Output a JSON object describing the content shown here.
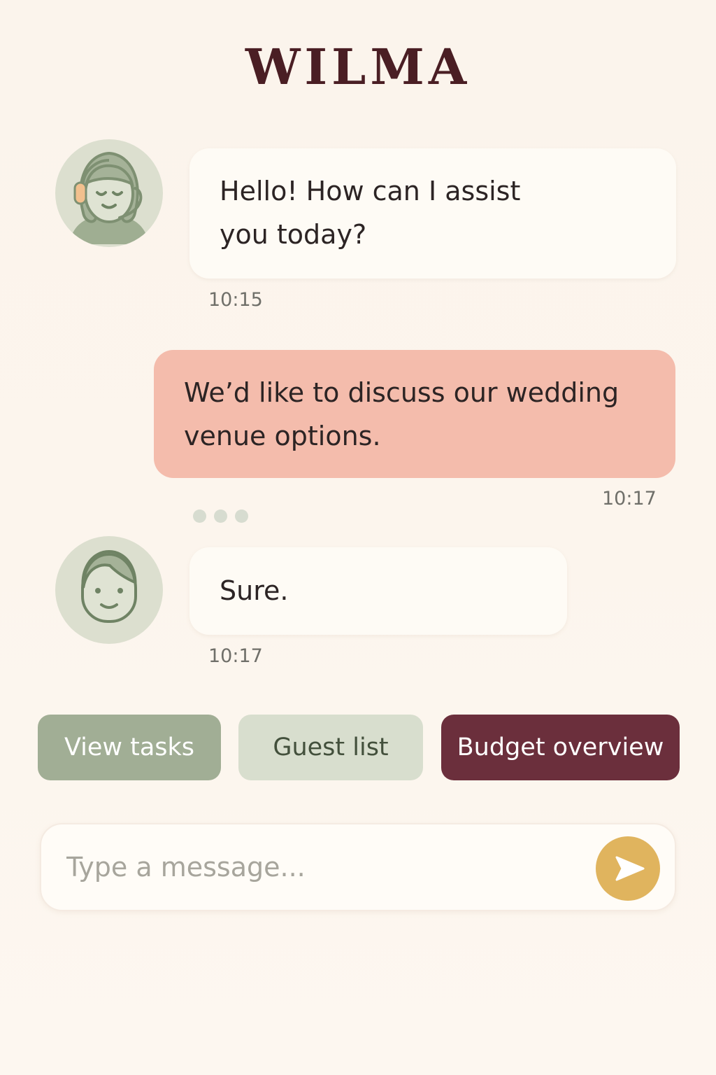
{
  "app": {
    "title": "WILMA"
  },
  "messages": [
    {
      "sender": "bot",
      "avatar": "assistant-avatar-icon",
      "lines": [
        "Hello! How can I assist",
        "you today?"
      ],
      "time": "10:15"
    },
    {
      "sender": "user",
      "lines": [
        "We’d like to discuss our wedding",
        "venue options."
      ],
      "time": "10:17"
    },
    {
      "sender": "bot",
      "avatar": "user-face-avatar-icon",
      "lines": [
        "Sure."
      ],
      "time": "10:17"
    }
  ],
  "typing_indicator": {
    "icon": "typing-dots-icon"
  },
  "quick_actions": [
    {
      "label": "View tasks"
    },
    {
      "label": "Guest list"
    },
    {
      "label": "Budget overview"
    }
  ],
  "composer": {
    "placeholder": "Type a message...",
    "value": "",
    "send_icon": "send-arrow-icon"
  },
  "colors": {
    "background": "#fcf6ee",
    "title": "#4a1e24",
    "user_bubble": "#f4bcac",
    "bot_bubble": "#fefbf5",
    "chip_view_tasks": "#a1ae95",
    "chip_guest_list": "#d8dece",
    "chip_budget": "#6b2f3c",
    "send_button": "#e0b45e"
  }
}
